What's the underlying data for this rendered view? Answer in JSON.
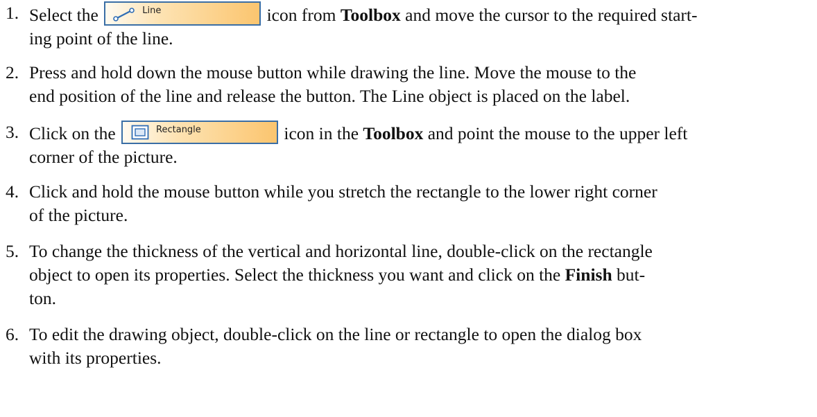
{
  "steps": [
    {
      "number": "1.",
      "before": "Select the ",
      "button_label": "Line",
      "button_icon": "line-tool-icon",
      "after_button": " icon from ",
      "bold1": "Toolbox",
      "after_bold1": " and move the cursor to the required start-",
      "continuation": "ing point of the line."
    },
    {
      "number": "2.",
      "line1": "Press and hold down the mouse button while drawing the line. Move the mouse to the",
      "line2": "end position of the line and release the button. The Line object is placed on the label."
    },
    {
      "number": "3.",
      "before": "Click on the ",
      "button_label": "Rectangle",
      "button_icon": "rectangle-tool-icon",
      "after_button": " icon in the ",
      "bold1": "Toolbox",
      "after_bold1": " and point the mouse to the upper left",
      "continuation": "corner of the picture."
    },
    {
      "number": "4.",
      "line1": "Click and hold the mouse button while you stretch the rectangle to the lower right corner",
      "line2": "of the picture."
    },
    {
      "number": "5.",
      "line1": "To change the thickness of the vertical and horizontal line, double-click on the rectangle",
      "line2_before": "object to open its properties. Select the thickness you want and click on the ",
      "bold1": "Finish",
      "line2_after": " but-",
      "line3": "ton."
    },
    {
      "number": "6.",
      "line1": "To edit the drawing object, double-click on the line or rectangle to open the dialog box",
      "line2": "with its properties."
    }
  ],
  "colors": {
    "text": "#111111",
    "button_border": "#3a6ea5",
    "button_gradient_start": "#fffaf0",
    "button_gradient_end": "#fbc56f",
    "icon_stroke": "#2f6db5"
  }
}
